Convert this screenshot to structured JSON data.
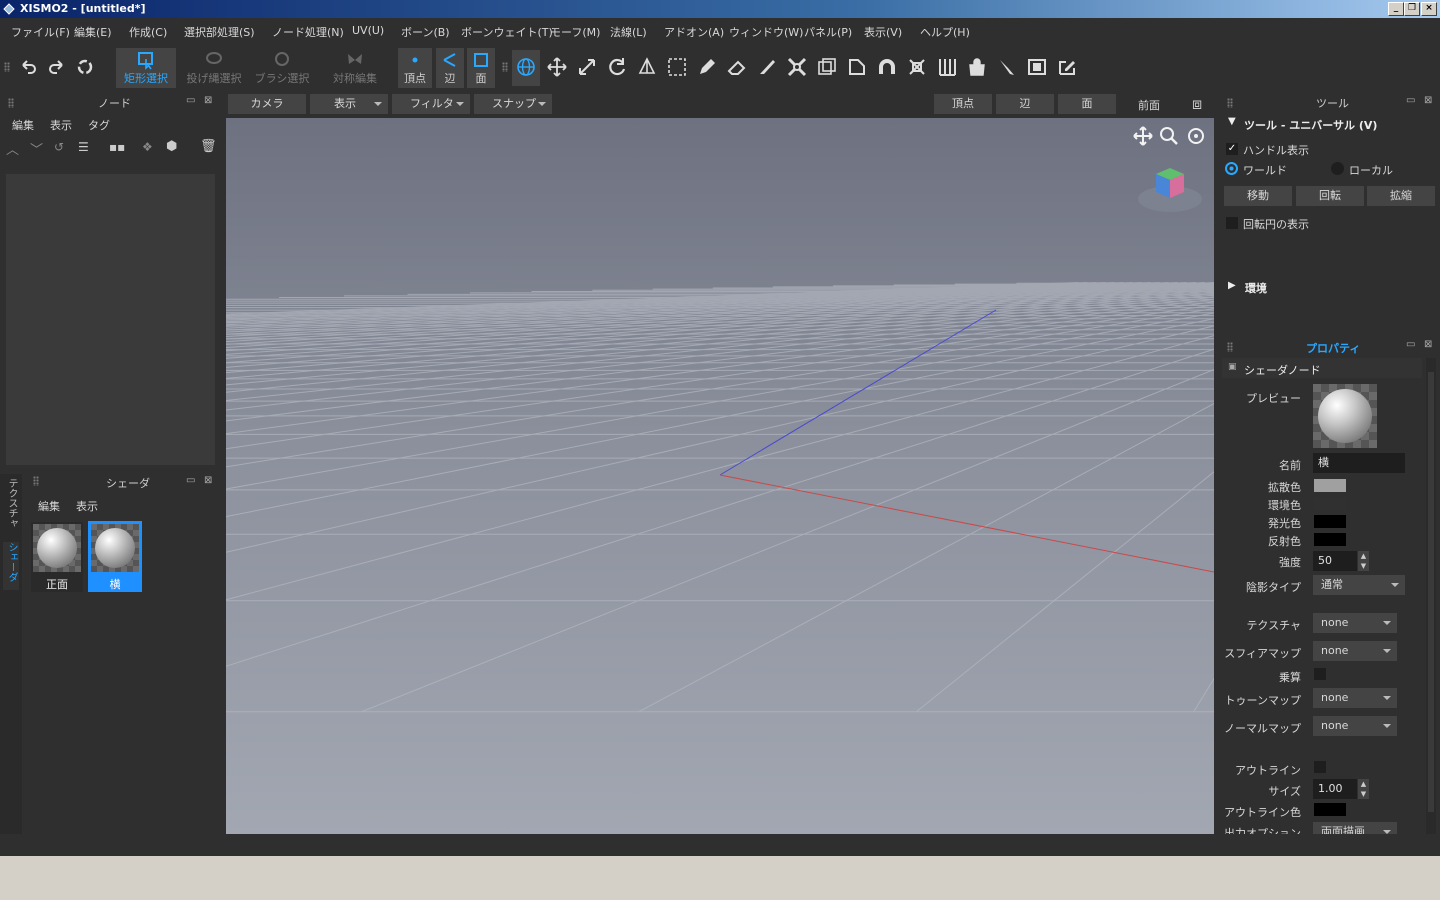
{
  "window": {
    "title": "XISMO2 - [untitled*]",
    "min": "_",
    "restore": "❐",
    "close": "×"
  },
  "menu": [
    "ファイル(F)",
    "編集(E)",
    "作成(C)",
    "選択部処理(S)",
    "ノード処理(N)",
    "UV(U)",
    "ボーン(B)",
    "ボーンウェイト(T)",
    "モーフ(M)",
    "法線(L)",
    "アドオン(A)",
    "ウィンドウ(W)",
    "パネル(P)",
    "表示(V)",
    "ヘルプ(H)"
  ],
  "toolbar": {
    "rect_select": "矩形選択",
    "lasso_select": "投げ縄選択",
    "brush_select": "ブラシ選択",
    "symmetric_edit": "対称編集",
    "vertex": "頂点",
    "edge": "辺",
    "face": "面"
  },
  "node_panel": {
    "title": "ノード",
    "menu": [
      "編集",
      "表示",
      "タグ"
    ]
  },
  "shader_panel": {
    "title": "シェーダ",
    "menu": [
      "編集",
      "表示"
    ],
    "items": [
      {
        "label": "正面"
      },
      {
        "label": "横"
      }
    ],
    "side_tabs": [
      "テクスチャ",
      "シェーダ"
    ]
  },
  "viewport_bar": {
    "camera": "カメラ",
    "display": "表示",
    "filter": "フィルタ",
    "snap": "スナップ",
    "vertex": "頂点",
    "edge": "辺",
    "face": "面",
    "view": "前面"
  },
  "tool_panel": {
    "title": "ツール",
    "section": "ツール - ユニバーサル (V)",
    "handle_display": "ハンドル表示",
    "world": "ワールド",
    "local": "ローカル",
    "move": "移動",
    "rotate": "回転",
    "scale": "拡縮",
    "rotation_circle": "回転円の表示",
    "environment": "環境"
  },
  "property_panel": {
    "title": "プロパティ",
    "section": "シェーダノード",
    "preview": "プレビュー",
    "name_label": "名前",
    "name_value": "横",
    "diffuse": "拡散色",
    "ambient": "環境色",
    "emissive": "発光色",
    "specular": "反射色",
    "strength_label": "強度",
    "strength_value": "50",
    "shade_type_label": "陰影タイプ",
    "shade_type_value": "通常",
    "texture_label": "テクスチャ",
    "texture_value": "none",
    "sphere_label": "スフィアマップ",
    "sphere_value": "none",
    "multiply_label": "乗算",
    "toon_label": "トゥーンマップ",
    "toon_value": "none",
    "normal_label": "ノーマルマップ",
    "normal_value": "none",
    "outline_label": "アウトライン",
    "size_label": "サイズ",
    "size_value": "1.00",
    "outline_color_label": "アウトライン色",
    "output_label": "出力オプション",
    "output_value": "両面描画"
  },
  "colors": {
    "accent": "#1e90ff",
    "panel": "#2f2f2f",
    "diffuse": "#a0a0a0",
    "ambient": "#303030",
    "emissive": "#000000",
    "specular": "#000000",
    "outline_color": "#000000",
    "axis_x": "#c04040",
    "axis_z": "#4040c0"
  }
}
